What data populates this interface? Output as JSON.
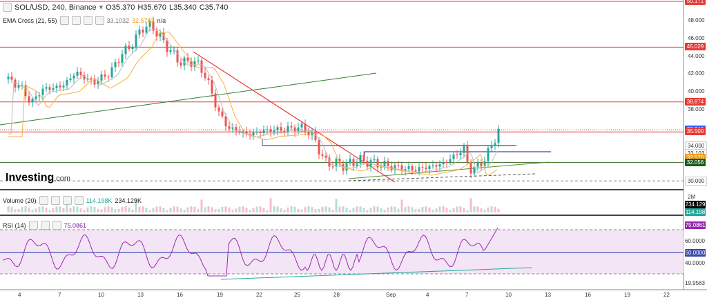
{
  "header": {
    "symbol": "SOL/USD, 240, Binance",
    "open": "O35.370",
    "high": "H35.670",
    "low": "L35.340",
    "close": "C35.740",
    "ema_label": "EMA Cross (21, 55)",
    "ema1": "33.1032",
    "ema2": "32.5763",
    "ema_na": "n/a"
  },
  "volume_header": {
    "label": "Volume (20)",
    "v1": "114.198K",
    "v2": "234.129K"
  },
  "rsi_header": {
    "label": "RSI (14)",
    "value": "75.0861"
  },
  "logo": {
    "name": "Investing",
    "suffix": ".com"
  },
  "price_axis": [
    "48.000",
    "46.000",
    "44.000",
    "42.000",
    "40.000",
    "38.000",
    "36.000",
    "34.000",
    "32.000",
    "30.000"
  ],
  "price_tags": [
    {
      "text": "50.171",
      "color": "#e53935"
    },
    {
      "text": "45.029",
      "color": "#e53935"
    },
    {
      "text": "38.874",
      "color": "#e53935"
    },
    {
      "text": "35.740",
      "color": "#2962ff"
    },
    {
      "text": "35.500",
      "color": "#e53935"
    },
    {
      "text": "34.000",
      "color": "#ffffff"
    },
    {
      "text": "33.103",
      "color": "#ffffff"
    },
    {
      "text": "32.576",
      "color": "#f39c12"
    },
    {
      "text": "32.056",
      "color": "#1b5e20"
    },
    {
      "text": "30.000",
      "color": "#ffffff"
    }
  ],
  "volume_axis": [
    "2M",
    "234.129",
    "114.198"
  ],
  "rsi_axis": [
    "75.0861",
    "60.0000",
    "50.0000",
    "40.0000",
    "19.9563"
  ],
  "time_axis": [
    "4",
    "7",
    "10",
    "13",
    "16",
    "19",
    "22",
    "25",
    "28",
    "Sep",
    "4",
    "7",
    "10",
    "13",
    "16",
    "19",
    "22"
  ],
  "colors": {
    "up": "#26a69a",
    "down": "#ef5350",
    "red_line": "#e53935",
    "blue_line": "#3949ab",
    "green_line": "#2e7d32",
    "rsi": "#9c27b0"
  }
}
